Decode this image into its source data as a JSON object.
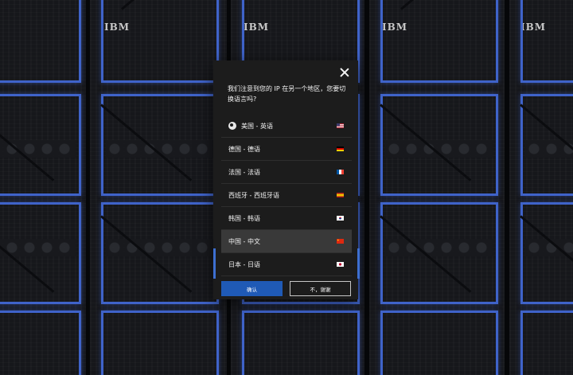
{
  "brand_label": "IBM",
  "modal": {
    "close_icon": "close-icon",
    "prompt": "我们注意到您的 IP 在另一个地区，您要切换语言吗?",
    "languages": [
      {
        "label": "美国 - 英语",
        "flag": "us-flag-icon",
        "current": true
      },
      {
        "label": "德国 - 德语",
        "flag": "de-flag-icon"
      },
      {
        "label": "法国 - 法语",
        "flag": "fr-flag-icon"
      },
      {
        "label": "西班牙 - 西班牙语",
        "flag": "es-flag-icon"
      },
      {
        "label": "韩国 - 韩语",
        "flag": "kr-flag-icon"
      },
      {
        "label": "中国 - 中文",
        "flag": "cn-flag-icon",
        "selected": true
      },
      {
        "label": "日本 - 日语",
        "flag": "jp-flag-icon"
      }
    ],
    "confirm_label": "确认",
    "decline_label": "不，谢谢"
  },
  "colors": {
    "accent": "#1f5ab6",
    "rack_frame": "#3f63c9",
    "modal_bg": "#1c1c1c",
    "selected_row": "#393939"
  }
}
